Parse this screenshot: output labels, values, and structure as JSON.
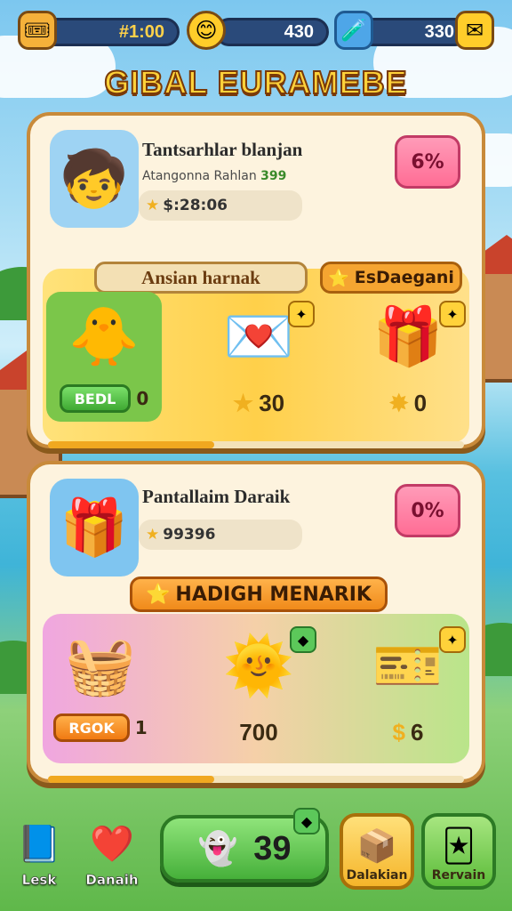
{
  "top_bar": {
    "coins_value": "#1:00",
    "gems_value": "430",
    "energy_value": "330"
  },
  "title": "GIBAL EURAMEBE",
  "card1": {
    "title": "Tantsarhlar blanjan",
    "subtitle": "Atangonna Rahlan",
    "subtitle_count": "399",
    "score": "$:28:06",
    "percent_badge": "6%",
    "ribbon_left": "Ansian harnak",
    "ribbon_right": "EsDaegani",
    "rewards": [
      {
        "icon": "character-reward-icon",
        "button": "BEDL",
        "value": "0"
      },
      {
        "icon": "gift-envelope-icon",
        "value": "30"
      },
      {
        "icon": "treasure-box-icon",
        "value": "0"
      }
    ],
    "progress_percent": 40
  },
  "card2": {
    "title": "Pantallaim Daraik",
    "score": "99396",
    "percent_badge": "0%",
    "ribbon": "HADIGH MENARIK",
    "rewards": [
      {
        "icon": "basket-chest-icon",
        "button": "RGOK",
        "value": "1"
      },
      {
        "icon": "sun-badge-icon",
        "value": "700"
      },
      {
        "icon": "ticket-icon",
        "value": "6"
      }
    ],
    "progress_percent": 40
  },
  "bottom_nav": {
    "left_item": "Lesk",
    "heart_item": "Danaih",
    "center_value": "39",
    "tile1": "Dalakian",
    "tile2": "Rervain"
  },
  "colors": {
    "accent_gold": "#ffd23a",
    "card_border": "#c88a3a",
    "badge_pink": "#ff6d95",
    "button_green": "#46b03a"
  }
}
